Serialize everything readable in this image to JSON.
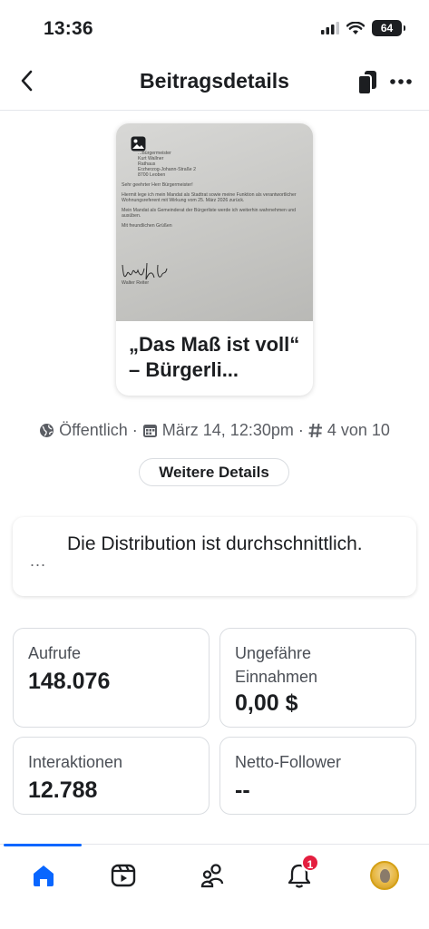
{
  "status_bar": {
    "time": "13:36",
    "battery": "64"
  },
  "header": {
    "title": "Beitragsdetails"
  },
  "post": {
    "title": "„Das Maß ist voll“ – Bürgerli...",
    "letter": {
      "address_lines": [
        "...Bürgermeister",
        "Kurt Wallner",
        "Rathaus",
        "Erzherzog-Johann-Straße 2",
        "8700 Leoben"
      ],
      "salutation": "Sehr geehrter Herr Bürgermeister!",
      "paragraph1": "Hiermit lege ich mein Mandat als Stadtrat sowie meine Funktion als verantwortlicher Wohnungsreferent mit Wirkung vom 25. März 2026 zurück.",
      "paragraph2": "Mein Mandat als Gemeinderat der Bürgerliste werde ich weiterhin wahrnehmen und ausüben.",
      "closing": "Mit freundlichen Grüßen",
      "signer": "Walter Reiter"
    }
  },
  "meta": {
    "visibility": "Öffentlich",
    "date": "März 14, 12:30pm",
    "rank": "4 von 10",
    "separator": "·"
  },
  "details_button": "Weitere Details",
  "distribution": {
    "dots": "...",
    "text": "Die Distribution ist durchschnittlich."
  },
  "stats": [
    {
      "label": "Aufrufe",
      "value": "148.076"
    },
    {
      "label": "Ungefähre Einnahmen",
      "value": "0,00 $"
    },
    {
      "label": "Interaktionen",
      "value": "12.788"
    },
    {
      "label": "Netto-Follower",
      "value": "--"
    }
  ],
  "tab_bar": {
    "notification_count": "1",
    "accent_color": "#0866ff",
    "badge_color": "#e41e3f",
    "icons": [
      "home-icon",
      "video-icon",
      "friends-icon",
      "bell-icon",
      "profile-avatar"
    ]
  }
}
